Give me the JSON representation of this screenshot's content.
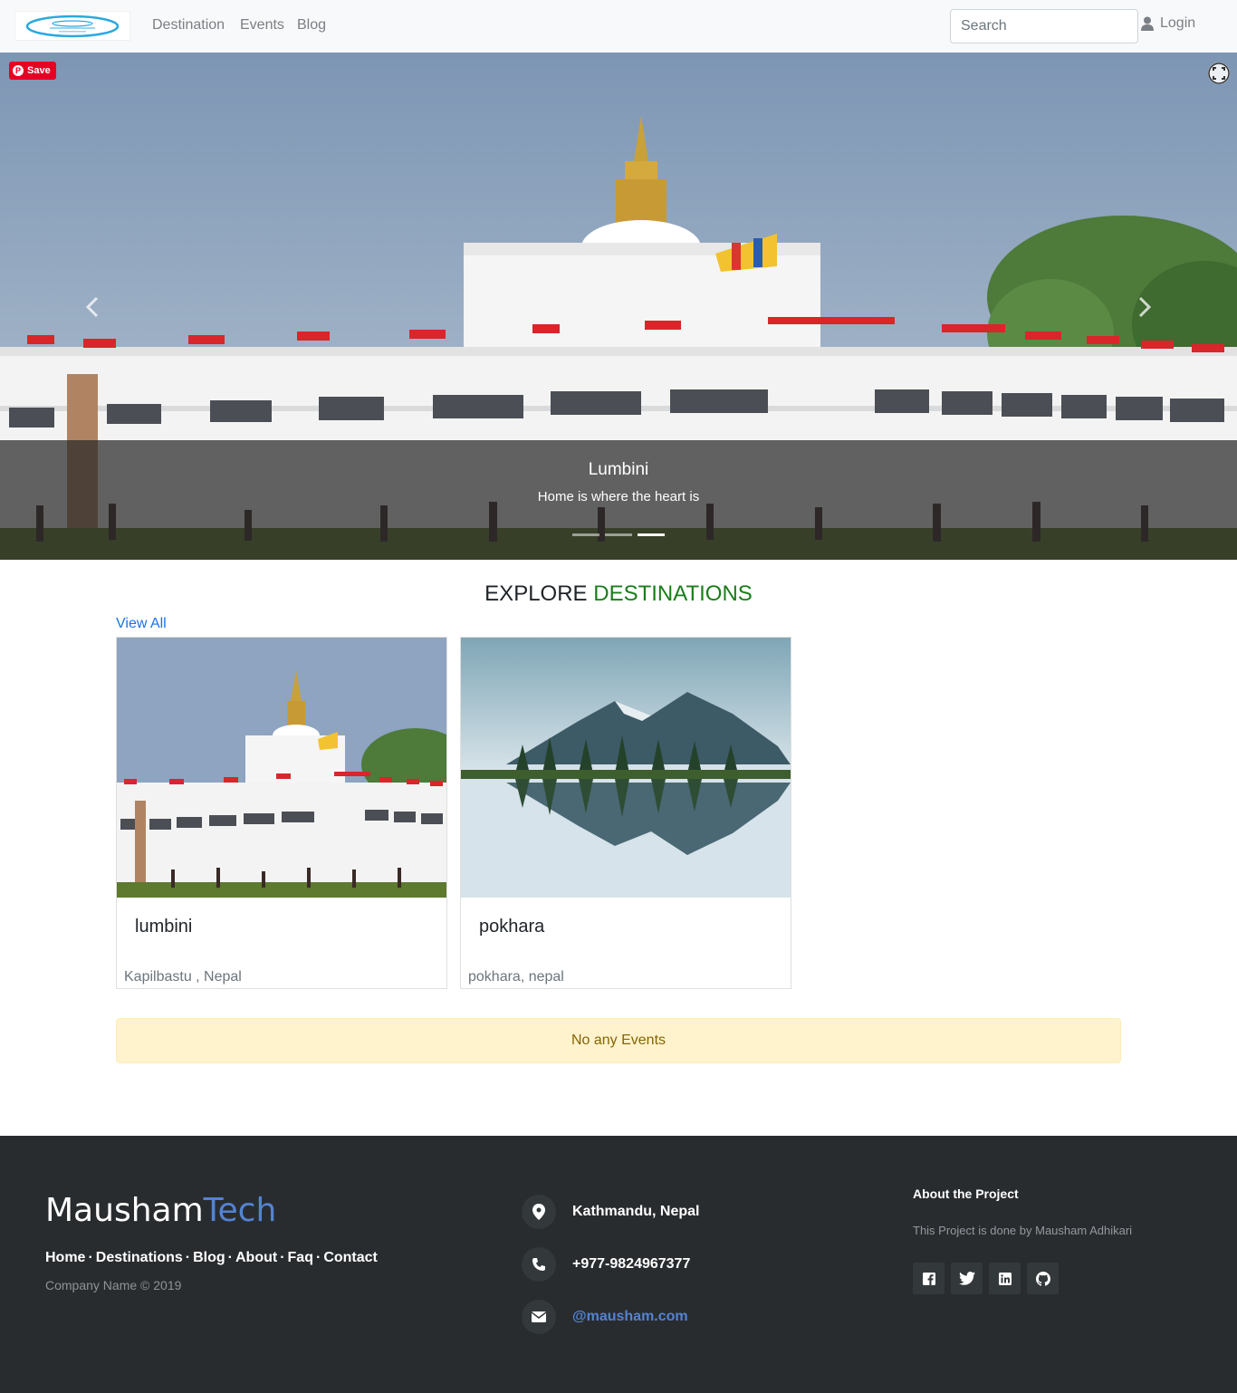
{
  "navbar": {
    "links": [
      "Destination",
      "Events",
      "Blog"
    ],
    "search_placeholder": "Search",
    "login_label": "Login"
  },
  "hero": {
    "pin_save_label": "Save",
    "caption_title": "Lumbini",
    "caption_text": "Home is where the heart is",
    "slide_count": 3,
    "active_slide": 3
  },
  "explore": {
    "title_main": "EXPLORE",
    "title_accent": "DESTINATIONS",
    "view_all": "View All",
    "cards": [
      {
        "title": "lumbini",
        "location": "Kapilbastu , Nepal"
      },
      {
        "title": "pokhara",
        "location": "pokhara, nepal"
      }
    ]
  },
  "events": {
    "empty_message": "No any Events"
  },
  "footer": {
    "brand_main": "Mausham",
    "brand_accent": "Tech",
    "links": [
      "Home",
      "Destinations",
      "Blog",
      "About",
      "Faq",
      "Contact"
    ],
    "copyright": "Company Name © 2019",
    "address": "Kathmandu, Nepal",
    "phone": "+977-9824967377",
    "email": "@mausham.com",
    "about_title": "About the Project",
    "about_text": "This Project is done by Mausham Adhikari",
    "socials": [
      "facebook-icon",
      "twitter-icon",
      "linkedin-icon",
      "github-icon"
    ]
  },
  "colors": {
    "accent_green": "#1a7d1a",
    "link_blue": "#1a73e8",
    "brand_blue": "#5383d3",
    "footer_bg": "#292c2f",
    "alert_bg": "#fff3cd"
  }
}
